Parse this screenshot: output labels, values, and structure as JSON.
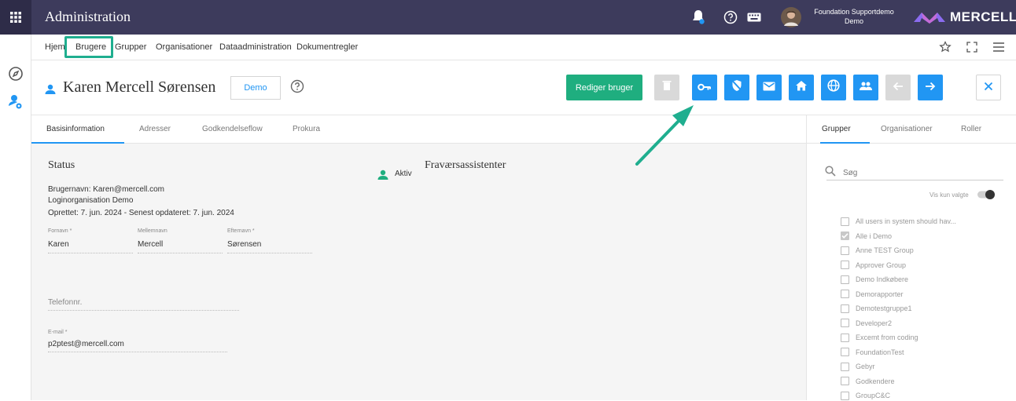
{
  "app": {
    "title": "Administration"
  },
  "topbar": {
    "user_line1": "Foundation Supportdemo",
    "user_line2": "Demo",
    "brand": "MERCELL",
    "icons": [
      "apps-grid-icon",
      "bell-icon",
      "help-icon",
      "keyboard-icon",
      "avatar",
      "mercell-logo"
    ]
  },
  "nav": {
    "items": [
      "Hjem",
      "Brugere",
      "Grupper",
      "Organisationer",
      "Dataadministration",
      "Dokumentregler"
    ],
    "active": "Brugere",
    "right_icons": [
      "star-icon",
      "fullscreen-icon",
      "menu-icon"
    ]
  },
  "header": {
    "user_name": "Karen Mercell Sørensen",
    "org_chip": "Demo",
    "edit_label": "Rediger bruger",
    "actions": [
      "delete-icon",
      "key-icon",
      "shield-off-icon",
      "mail-icon",
      "home-icon",
      "globe-icon",
      "group-icon",
      "arrow-left-icon",
      "arrow-right-icon",
      "close-icon"
    ]
  },
  "tabs": [
    "Basisinformation",
    "Adresser",
    "Godkendelseflow",
    "Prokura"
  ],
  "status": {
    "title": "Status",
    "active_label": "Aktiv",
    "brugernavn": "Brugernavn: Karen@mercell.com",
    "loginorg": "Loginorganisation Demo",
    "dates": "Oprettet: 7. jun. 2024 - Senest opdateret: 7. jun. 2024"
  },
  "fravaer": {
    "title": "Fraværsassistenter"
  },
  "fields": {
    "fornavn_label": "Fornavn *",
    "fornavn": "Karen",
    "mellemnavn_label": "Mellemnavn",
    "mellemnavn": "Mercell",
    "efternavn_label": "Efternavn *",
    "efternavn": "Sørensen",
    "telefon_placeholder": "Telefonnr.",
    "email_label": "E-mail *",
    "email": "p2ptest@mercell.com"
  },
  "right_panel": {
    "tabs": [
      "Grupper",
      "Organisationer",
      "Roller"
    ],
    "search_placeholder": "Søg",
    "vis_kun_valgte": "Vis kun valgte",
    "groups": [
      {
        "label": "All users in system should hav...",
        "checked": false
      },
      {
        "label": "Alle i Demo",
        "checked": true
      },
      {
        "label": "Anne TEST Group",
        "checked": false
      },
      {
        "label": "Approver Group",
        "checked": false
      },
      {
        "label": "Demo Indkøbere",
        "checked": false
      },
      {
        "label": "Demorapporter",
        "checked": false
      },
      {
        "label": "Demotestgruppe1",
        "checked": false
      },
      {
        "label": "Developer2",
        "checked": false
      },
      {
        "label": "Excemt from coding",
        "checked": false
      },
      {
        "label": "FoundationTest",
        "checked": false
      },
      {
        "label": "Gebyr",
        "checked": false
      },
      {
        "label": "Godkendere",
        "checked": false
      },
      {
        "label": "GroupC&C",
        "checked": false
      }
    ]
  },
  "colors": {
    "topbar": "#3d3b5c",
    "accent": "#2196f3",
    "primary_green": "#1fae7f",
    "highlight": "#1fae8f"
  }
}
